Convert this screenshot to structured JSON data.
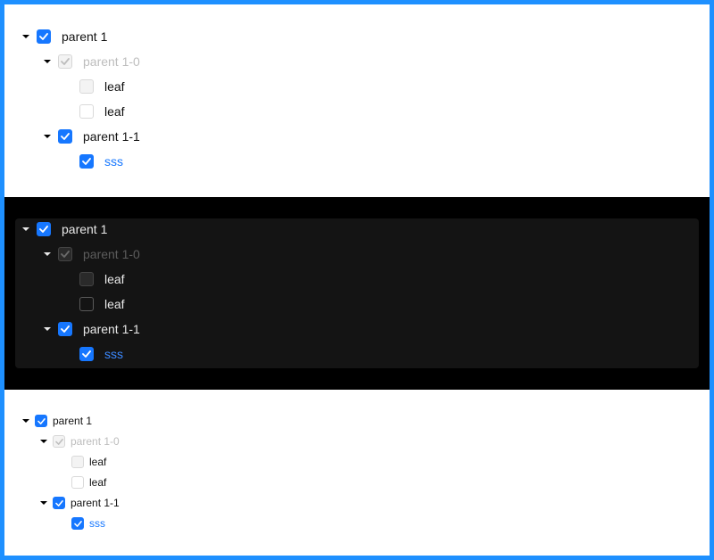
{
  "colors": {
    "accent": "#1677ff",
    "frame_border": "#1e90ff",
    "dark_background": "#000000",
    "dark_panel": "#141414"
  },
  "trees": [
    {
      "theme": "light",
      "size": "default",
      "nodes": [
        {
          "label": "parent 1",
          "state": "checked",
          "expanded": true
        },
        {
          "label": "parent 1-0",
          "state": "checked-disabled",
          "expanded": true
        },
        {
          "label": "leaf",
          "state": "unchecked-disabled"
        },
        {
          "label": "leaf",
          "state": "unchecked"
        },
        {
          "label": "parent 1-1",
          "state": "checked",
          "expanded": true
        },
        {
          "label": "sss",
          "state": "checked"
        }
      ]
    },
    {
      "theme": "dark",
      "size": "default",
      "nodes": [
        {
          "label": "parent 1",
          "state": "checked",
          "expanded": true
        },
        {
          "label": "parent 1-0",
          "state": "checked-disabled",
          "expanded": true
        },
        {
          "label": "leaf",
          "state": "unchecked-disabled"
        },
        {
          "label": "leaf",
          "state": "unchecked"
        },
        {
          "label": "parent 1-1",
          "state": "checked",
          "expanded": true
        },
        {
          "label": "sss",
          "state": "checked"
        }
      ]
    },
    {
      "theme": "light",
      "size": "small",
      "nodes": [
        {
          "label": "parent 1",
          "state": "checked",
          "expanded": true
        },
        {
          "label": "parent 1-0",
          "state": "checked-disabled",
          "expanded": true
        },
        {
          "label": "leaf",
          "state": "unchecked-disabled"
        },
        {
          "label": "leaf",
          "state": "unchecked"
        },
        {
          "label": "parent 1-1",
          "state": "checked",
          "expanded": true
        },
        {
          "label": "sss",
          "state": "checked"
        }
      ]
    }
  ]
}
